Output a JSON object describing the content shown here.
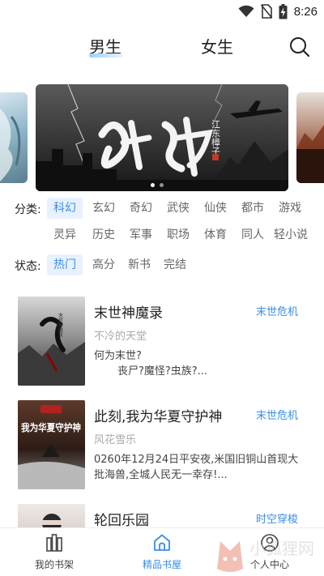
{
  "status_bar": {
    "time": "8:26",
    "icons": [
      "wifi-icon",
      "no-sim-icon",
      "battery-charging-icon"
    ]
  },
  "header": {
    "tabs": [
      {
        "label": "男生",
        "active": true
      },
      {
        "label": "女生",
        "active": false
      }
    ],
    "search_icon": "search-icon"
  },
  "banner": {
    "title_art": "蝉动",
    "author_art": "江东樟子",
    "dot_count": 2,
    "active_dot": 0
  },
  "filters": {
    "category": {
      "label": "分类:",
      "options": [
        "科幻",
        "玄幻",
        "奇幻",
        "武侠",
        "仙侠",
        "都市",
        "游戏",
        "灵异",
        "历史",
        "军事",
        "职场",
        "体育",
        "同人",
        "轻小说"
      ],
      "selected": "科幻"
    },
    "status": {
      "label": "状态:",
      "options": [
        "热门",
        "高分",
        "新书",
        "完结"
      ],
      "selected": "热门"
    }
  },
  "books": [
    {
      "title": "末世神魔录",
      "tag": "末世危机",
      "author": "不冷的天堂",
      "desc": "何为末世?\n       丧尸?魔怪?虫族?...",
      "cover_text": "末世神魔录"
    },
    {
      "title": "此刻,我为华夏守护神",
      "tag": "末世危机",
      "author": "风花雪乐",
      "desc": "0260年12月24日平安夜,米国旧铜山首现大批海兽,全城人民无一幸存!...",
      "cover_text": "我为华夏守护神"
    },
    {
      "title": "轮回乐园",
      "tag": "时空穿梭",
      "author": "",
      "desc": "",
      "cover_text": ""
    }
  ],
  "bottom_nav": {
    "items": [
      {
        "label": "我的书架",
        "icon": "bookshelf-icon",
        "active": false
      },
      {
        "label": "精品书屋",
        "icon": "home-icon",
        "active": true
      },
      {
        "label": "个人中心",
        "icon": "user-icon",
        "active": false
      }
    ]
  },
  "watermark": {
    "text": "小狐狸网"
  },
  "colors": {
    "accent": "#3a8ee6",
    "chip_bg": "#e8f2ff",
    "muted": "#aaaaaa"
  }
}
